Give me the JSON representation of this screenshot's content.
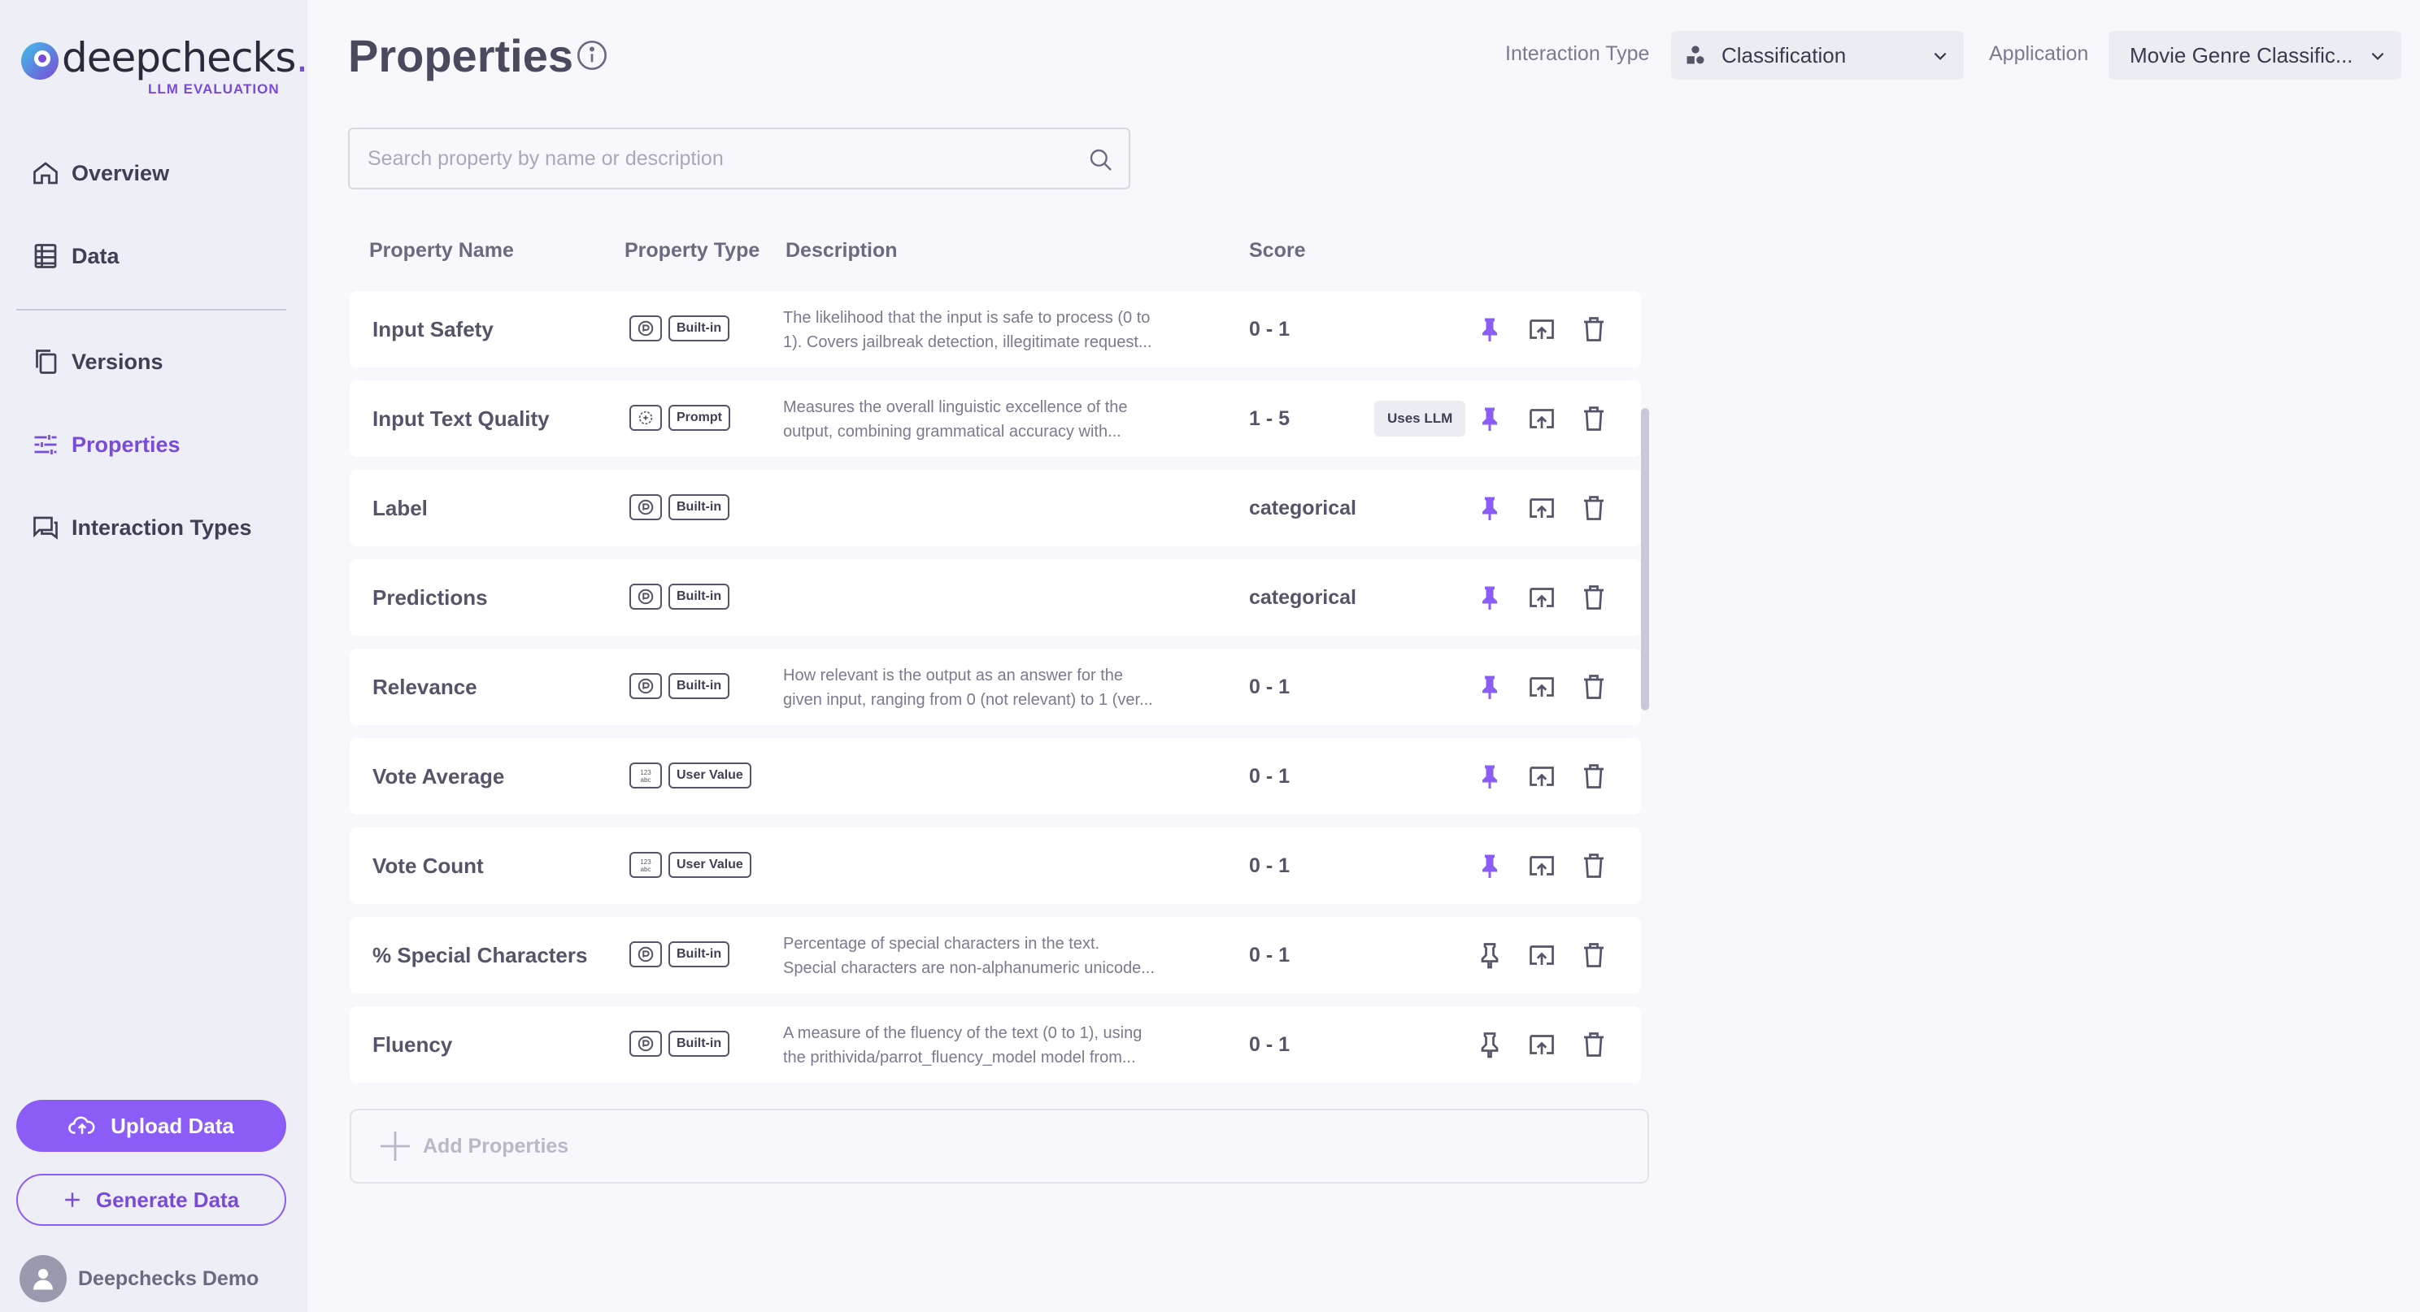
{
  "brand": {
    "name": "deepchecks",
    "dot": ".",
    "subtitle": "LLM EVALUATION"
  },
  "nav": [
    {
      "label": "Overview",
      "icon": "home-icon",
      "active": false
    },
    {
      "label": "Data",
      "icon": "table-icon",
      "active": false
    },
    {
      "label": "Versions",
      "icon": "copy-icon",
      "active": false
    },
    {
      "label": "Properties",
      "icon": "sliders-icon",
      "active": true
    },
    {
      "label": "Interaction Types",
      "icon": "chat-icon",
      "active": false
    }
  ],
  "buttons": {
    "upload": "Upload Data",
    "generate": "Generate Data"
  },
  "user": {
    "name": "Deepchecks Demo"
  },
  "header": {
    "title": "Properties",
    "interaction_type_label": "Interaction Type",
    "interaction_type_value": "Classification",
    "application_label": "Application",
    "application_value": "Movie Genre Classific..."
  },
  "search": {
    "placeholder": "Search property by name or description"
  },
  "table": {
    "columns": [
      "Property Name",
      "Property Type",
      "Description",
      "Score"
    ],
    "rows": [
      {
        "name": "Input Safety",
        "type_icon": "builtin-icon",
        "type": "Built-in",
        "desc1": "The likelihood that the input is safe to process (0 to",
        "desc2": "1). Covers jailbreak detection, illegitimate request...",
        "score": "0 - 1",
        "badge": "",
        "pinned": true
      },
      {
        "name": "Input Text Quality",
        "type_icon": "prompt-icon",
        "type": "Prompt",
        "desc1": "Measures the overall linguistic excellence of the",
        "desc2": "output, combining grammatical accuracy with...",
        "score": "1 - 5",
        "badge": "Uses LLM",
        "pinned": true
      },
      {
        "name": "Label",
        "type_icon": "builtin-icon",
        "type": "Built-in",
        "desc1": "",
        "desc2": "",
        "score": "categorical",
        "badge": "",
        "pinned": true
      },
      {
        "name": "Predictions",
        "type_icon": "builtin-icon",
        "type": "Built-in",
        "desc1": "",
        "desc2": "",
        "score": "categorical",
        "badge": "",
        "pinned": true
      },
      {
        "name": "Relevance",
        "type_icon": "builtin-icon",
        "type": "Built-in",
        "desc1": "How relevant is the output as an answer for the",
        "desc2": "given input, ranging from 0 (not relevant) to 1 (ver...",
        "score": "0 - 1",
        "badge": "",
        "pinned": true
      },
      {
        "name": "Vote Average",
        "type_icon": "user-value-icon",
        "type": "User Value",
        "desc1": "",
        "desc2": "",
        "score": "0 - 1",
        "badge": "",
        "pinned": true
      },
      {
        "name": "Vote Count",
        "type_icon": "user-value-icon",
        "type": "User Value",
        "desc1": "",
        "desc2": "",
        "score": "0 - 1",
        "badge": "",
        "pinned": true
      },
      {
        "name": "% Special Characters",
        "type_icon": "builtin-icon",
        "type": "Built-in",
        "desc1": "Percentage of special characters in the text.",
        "desc2": "Special characters are non-alphanumeric unicode...",
        "score": "0 - 1",
        "badge": "",
        "pinned": false
      },
      {
        "name": "Fluency",
        "type_icon": "builtin-icon",
        "type": "Built-in",
        "desc1": "A measure of the fluency of the text (0 to 1), using",
        "desc2": "the prithivida/parrot_fluency_model model from...",
        "score": "0 - 1",
        "badge": "",
        "pinned": false
      }
    ]
  },
  "add_properties": "Add Properties",
  "colors": {
    "accent": "#8b5cf6",
    "sidebar_bg": "#eeeef6",
    "page_bg": "#f8f8fc"
  }
}
